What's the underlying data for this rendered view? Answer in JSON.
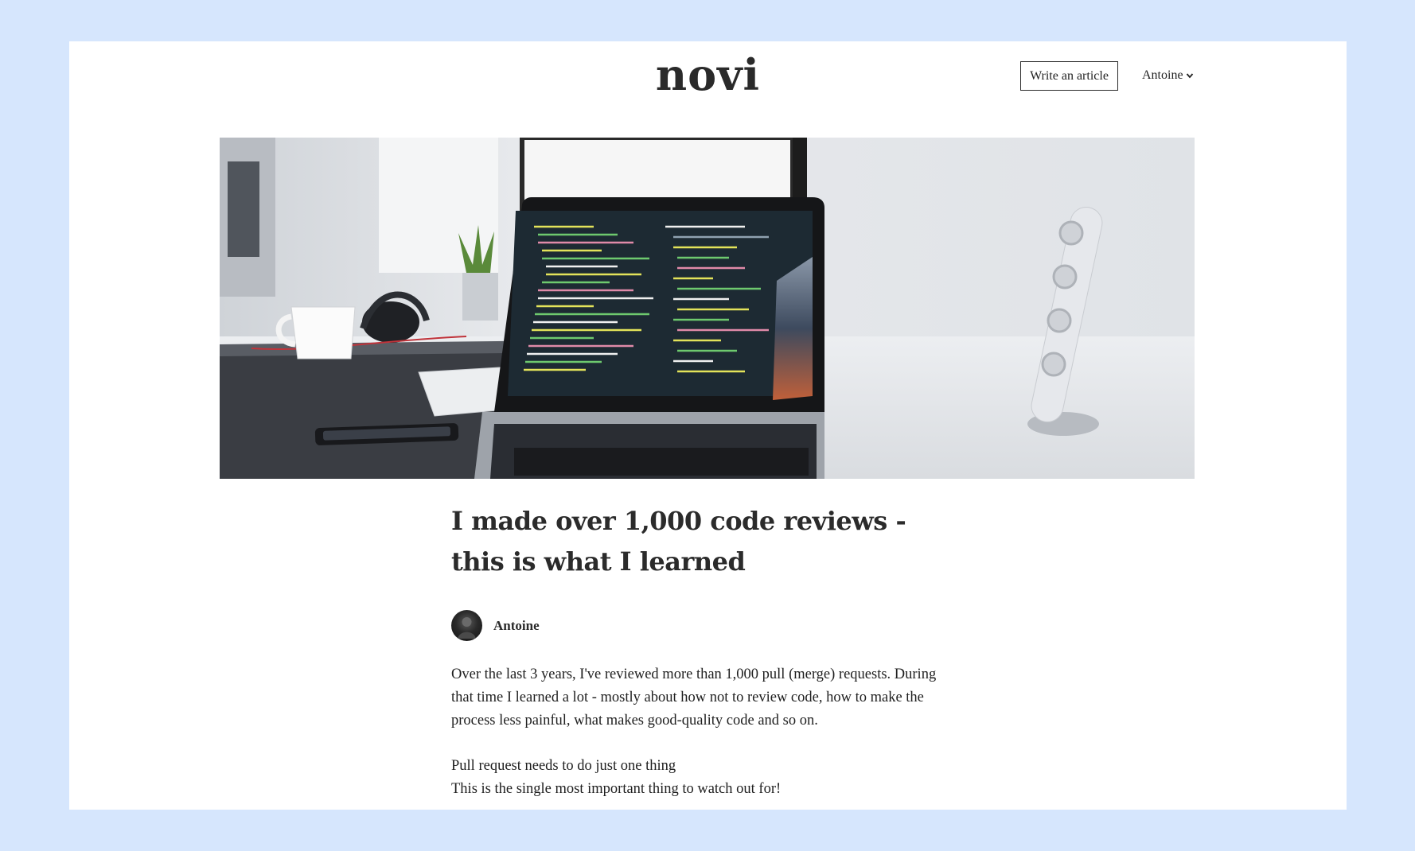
{
  "header": {
    "logo": "novi",
    "write_button": "Write an article",
    "user_menu": "Antoine"
  },
  "article": {
    "title": "I made over 1,000 code reviews - this is what I learned",
    "author": "Antoine",
    "paragraphs": [
      "Over the last 3 years, I've reviewed more than 1,000 pull (merge) requests. During that time I learned a lot - mostly about how not to review code, how to make the process less painful, what makes good-quality code and so on.",
      "Pull request needs to do just one thing",
      "This is the single most important thing to watch out for!"
    ]
  },
  "colors": {
    "background": "#d6e6fd",
    "page": "#ffffff",
    "text": "#2b2b2b"
  }
}
